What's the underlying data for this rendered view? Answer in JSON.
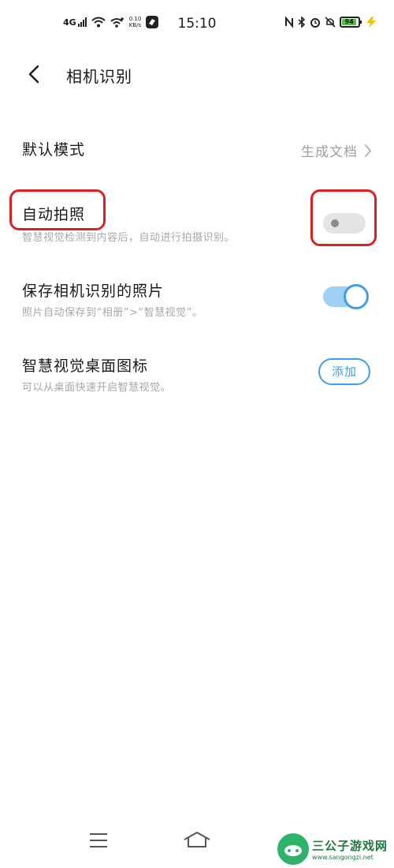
{
  "status_bar": {
    "network": "4G",
    "speed_value": "0.10",
    "speed_unit": "KB/s",
    "time": "15:10",
    "battery": "94"
  },
  "header": {
    "title": "相机识别"
  },
  "settings": {
    "default_mode": {
      "title": "默认模式",
      "value": "生成文档"
    },
    "auto_capture": {
      "title": "自动拍照",
      "subtitle": "智慧视觉检测到内容后，自动进行拍摄识别。",
      "enabled": false
    },
    "save_photos": {
      "title": "保存相机识别的照片",
      "subtitle": "照片自动保存到“相册”>“智慧视觉”。",
      "enabled": true
    },
    "desktop_icon": {
      "title": "智慧视觉桌面图标",
      "subtitle": "可以从桌面快速开启智慧视觉。",
      "button_label": "添加"
    }
  },
  "watermark": {
    "name": "三公子游戏网",
    "url": "www.sangongzi.net"
  },
  "colors": {
    "accent": "#3f9fe8",
    "annotation": "#e02020",
    "subtitle": "#a7a7a7"
  }
}
